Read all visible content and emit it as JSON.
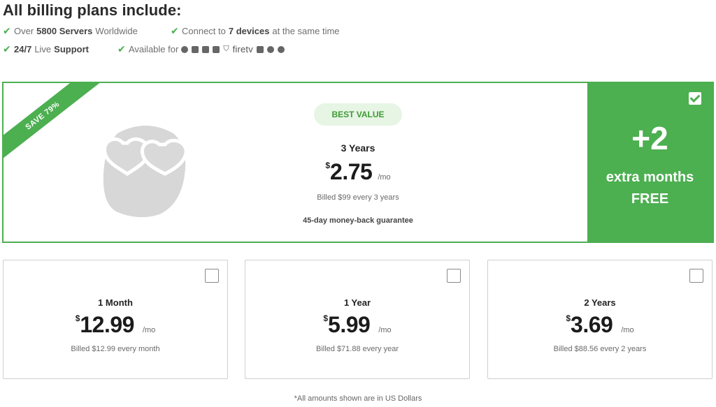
{
  "heading": "All billing plans include:",
  "features": {
    "servers": {
      "pre": "Over",
      "bold": "5800 Servers",
      "post": "Worldwide"
    },
    "devices": {
      "pre": "Connect to",
      "bold": "7 devices",
      "post": "at the same time"
    },
    "support": {
      "bold": "24/7",
      "mid": "Live",
      "bold2": "Support"
    },
    "platforms": {
      "pre": "Available for",
      "firetv": "firetv"
    }
  },
  "featured": {
    "ribbon": "SAVE 79%",
    "badge": "BEST VALUE",
    "term": "3 Years",
    "currency": "$",
    "price": "2.75",
    "per": "/mo",
    "billed": "Billed $99 every 3 years",
    "guarantee": "45-day money-back guarantee",
    "bonus_big": "+2",
    "bonus_line1": "extra months",
    "bonus_line2": "FREE",
    "selected": true
  },
  "plans": [
    {
      "term": "1 Month",
      "currency": "$",
      "price": "12.99",
      "per": "/mo",
      "billed": "Billed $12.99 every month",
      "selected": false
    },
    {
      "term": "1 Year",
      "currency": "$",
      "price": "5.99",
      "per": "/mo",
      "billed": "Billed $71.88 every year",
      "selected": false
    },
    {
      "term": "2 Years",
      "currency": "$",
      "price": "3.69",
      "per": "/mo",
      "billed": "Billed $88.56 every 2 years",
      "selected": false
    }
  ],
  "footnote": "*All amounts shown are in US Dollars",
  "colors": {
    "accent": "#4caf50",
    "badge_bg": "#e6f5e4",
    "badge_text": "#3e9a36"
  },
  "icons": [
    "check-icon",
    "apple-icon",
    "android-icon",
    "mac-finder-icon",
    "windows-icon",
    "linux-icon",
    "router-icon",
    "chrome-icon",
    "firefox-icon",
    "mascot-illustration"
  ]
}
